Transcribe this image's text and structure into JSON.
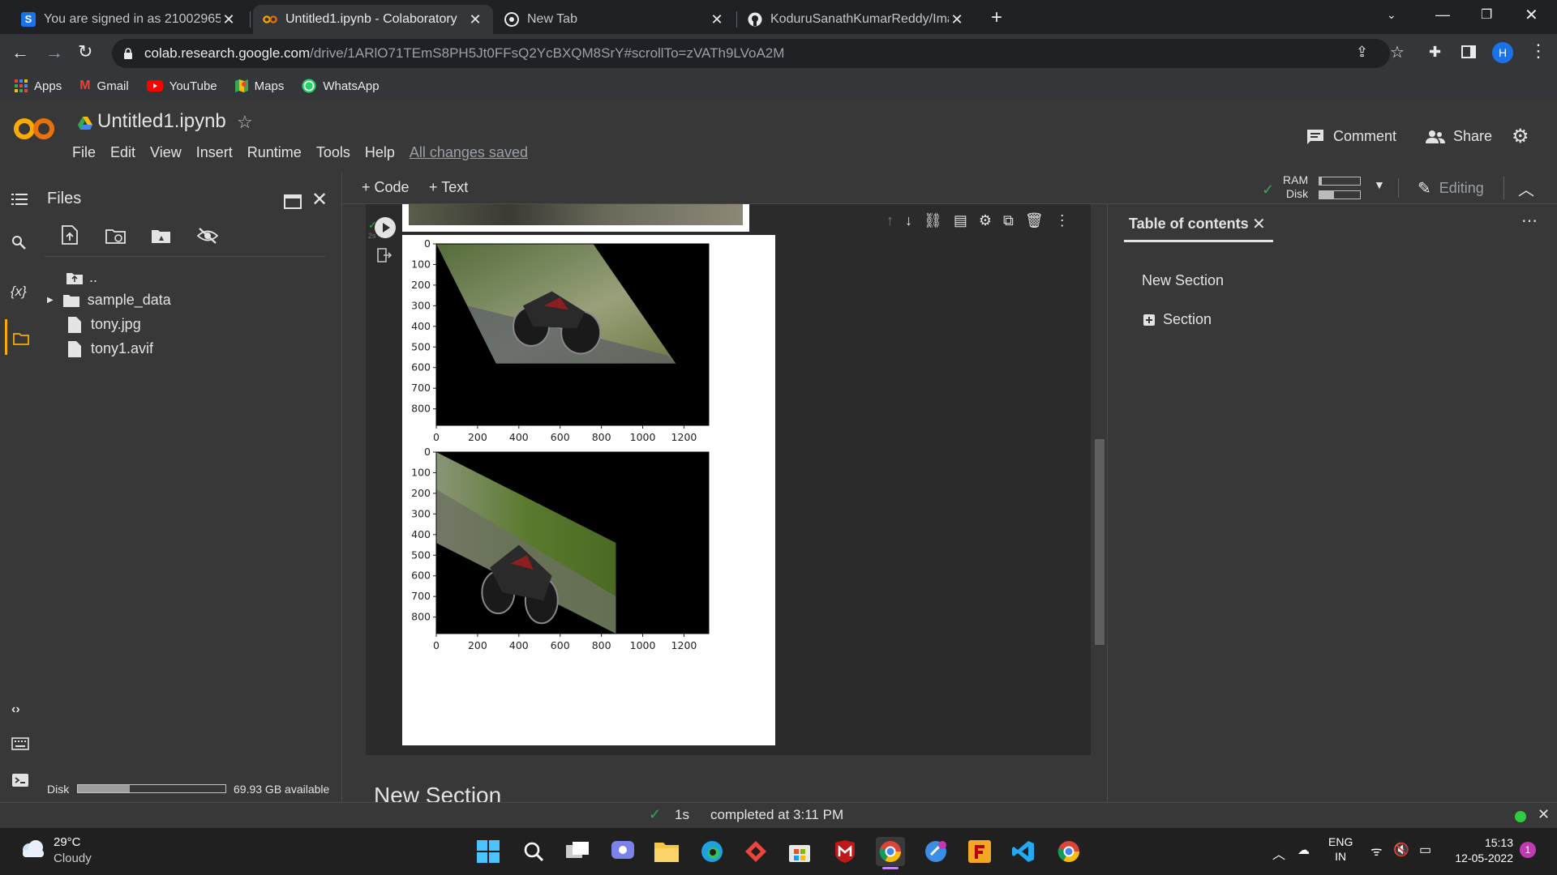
{
  "browser": {
    "tabs": [
      {
        "title": "You are signed in as 21002965",
        "active": false
      },
      {
        "title": "Untitled1.ipynb - Colaboratory",
        "active": true
      },
      {
        "title": "New Tab",
        "active": false
      },
      {
        "title": "KoduruSanathKumarReddy/Imag",
        "active": false
      }
    ],
    "url_host": "colab.research.google.com",
    "url_path": "/drive/1ARlO71TEmS8PH5Jt0FFsQ2YcBXQM8SrY#scrollTo=zVATh9LVoA2M",
    "profile_initial": "H",
    "bookmarks": [
      "Apps",
      "Gmail",
      "YouTube",
      "Maps",
      "WhatsApp"
    ]
  },
  "colab": {
    "logo": "CO",
    "notebook_title": "Untitled1.ipynb",
    "menu": [
      "File",
      "Edit",
      "View",
      "Insert",
      "Runtime",
      "Tools",
      "Help"
    ],
    "save_status": "All changes saved",
    "comment_label": "Comment",
    "share_label": "Share",
    "add_code": "+ Code",
    "add_text": "+ Text",
    "ram_label": "RAM",
    "disk_label": "Disk",
    "editing_label": "Editing"
  },
  "files_panel": {
    "title": "Files",
    "items": [
      "..",
      "sample_data",
      "tony.jpg",
      "tony1.avif"
    ],
    "disk_label": "Disk",
    "disk_available": "69.93 GB available",
    "disk_used_fraction": 0.35
  },
  "cell": {
    "exec_count": "2s",
    "next_section_heading": "New Section"
  },
  "chart_data": [
    {
      "type": "image",
      "x_ticks": [
        "0",
        "200",
        "400",
        "600",
        "800",
        "1000",
        "1200"
      ],
      "y_ticks": [
        "0",
        "100",
        "200",
        "300",
        "400",
        "500",
        "600",
        "700",
        "800"
      ],
      "xlim": [
        0,
        1320
      ],
      "ylim": [
        880,
        0
      ]
    },
    {
      "type": "image",
      "x_ticks": [
        "0",
        "200",
        "400",
        "600",
        "800",
        "1000",
        "1200"
      ],
      "y_ticks": [
        "0",
        "100",
        "200",
        "300",
        "400",
        "500",
        "600",
        "700",
        "800"
      ],
      "xlim": [
        0,
        1320
      ],
      "ylim": [
        880,
        0
      ]
    }
  ],
  "toc": {
    "tab_label": "Table of contents",
    "items": [
      "New Section",
      "Section"
    ]
  },
  "status": {
    "duration": "1s",
    "message": "completed at 3:11 PM"
  },
  "taskbar": {
    "temperature": "29°C",
    "weather": "Cloudy",
    "lang_top": "ENG",
    "lang_bottom": "IN",
    "time": "15:13",
    "date": "12-05-2022",
    "notifications": "1"
  }
}
